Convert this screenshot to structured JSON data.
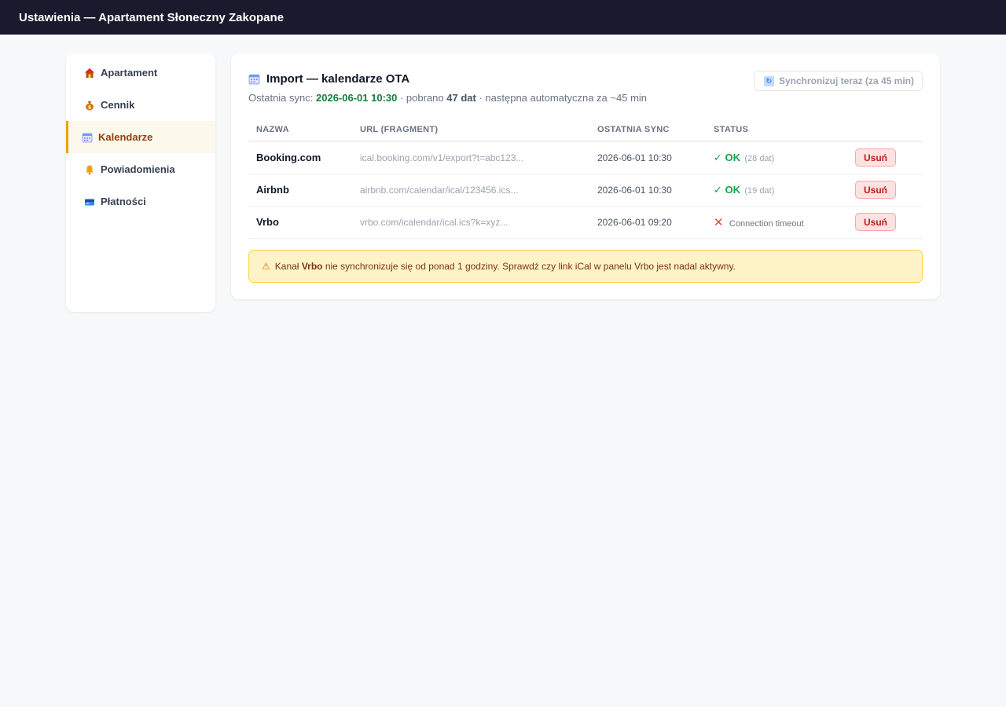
{
  "header": {
    "title": "Ustawienia — Apartament Słoneczny Zakopane"
  },
  "sidebar": {
    "items": [
      {
        "label": "Apartament",
        "icon": "house-icon"
      },
      {
        "label": "Cennik",
        "icon": "money-bag-icon"
      },
      {
        "label": "Kalendarze",
        "icon": "calendar-icon",
        "active": true
      },
      {
        "label": "Powiadomienia",
        "icon": "bell-icon"
      },
      {
        "label": "Płatności",
        "icon": "credit-card-icon"
      }
    ]
  },
  "main": {
    "title": "Import — kalendarze OTA",
    "sync_prefix": "Ostatnia sync:",
    "sync_datetime": "2026-06-01 10:30",
    "sync_fetched_prefix": "· pobrano",
    "sync_count": "47 dat",
    "sync_next": "· następna automatyczna za ~45 min",
    "sync_button": "Synchronizuj teraz (za 45 min)",
    "table": {
      "headers": [
        "NAZWA",
        "URL (FRAGMENT)",
        "OSTATNIA SYNC",
        "STATUS"
      ],
      "rows": [
        {
          "name": "Booking.com",
          "url": "ical.booking.com/v1/export?t=abc123...",
          "last_sync": "2026-06-01 10:30",
          "status": "OK",
          "status_detail": "(28 dat)",
          "ok": true,
          "delete": "Usuń"
        },
        {
          "name": "Airbnb",
          "url": "airbnb.com/calendar/ical/123456.ics...",
          "last_sync": "2026-06-01 10:30",
          "status": "OK",
          "status_detail": "(19 dat)",
          "ok": true,
          "delete": "Usuń"
        },
        {
          "name": "Vrbo",
          "url": "vrbo.com/icalendar/ical.ics?k=xyz...",
          "last_sync": "2026-06-01 09:20",
          "status": "",
          "status_detail": "Connection timeout",
          "ok": false,
          "delete": "Usuń"
        }
      ]
    },
    "alert": {
      "prefix": "Kanał",
      "channel": "Vrbo",
      "text": "nie synchronizuje się od ponad 1 godziny. Sprawdź czy link iCal w panelu Vrbo jest nadal aktywny."
    }
  },
  "colors": {
    "topbar": "#1a1a2e",
    "accent": "#f59e0b",
    "ok": "#16a34a",
    "error": "#ef4444",
    "alert_bg": "#fef3c7"
  }
}
